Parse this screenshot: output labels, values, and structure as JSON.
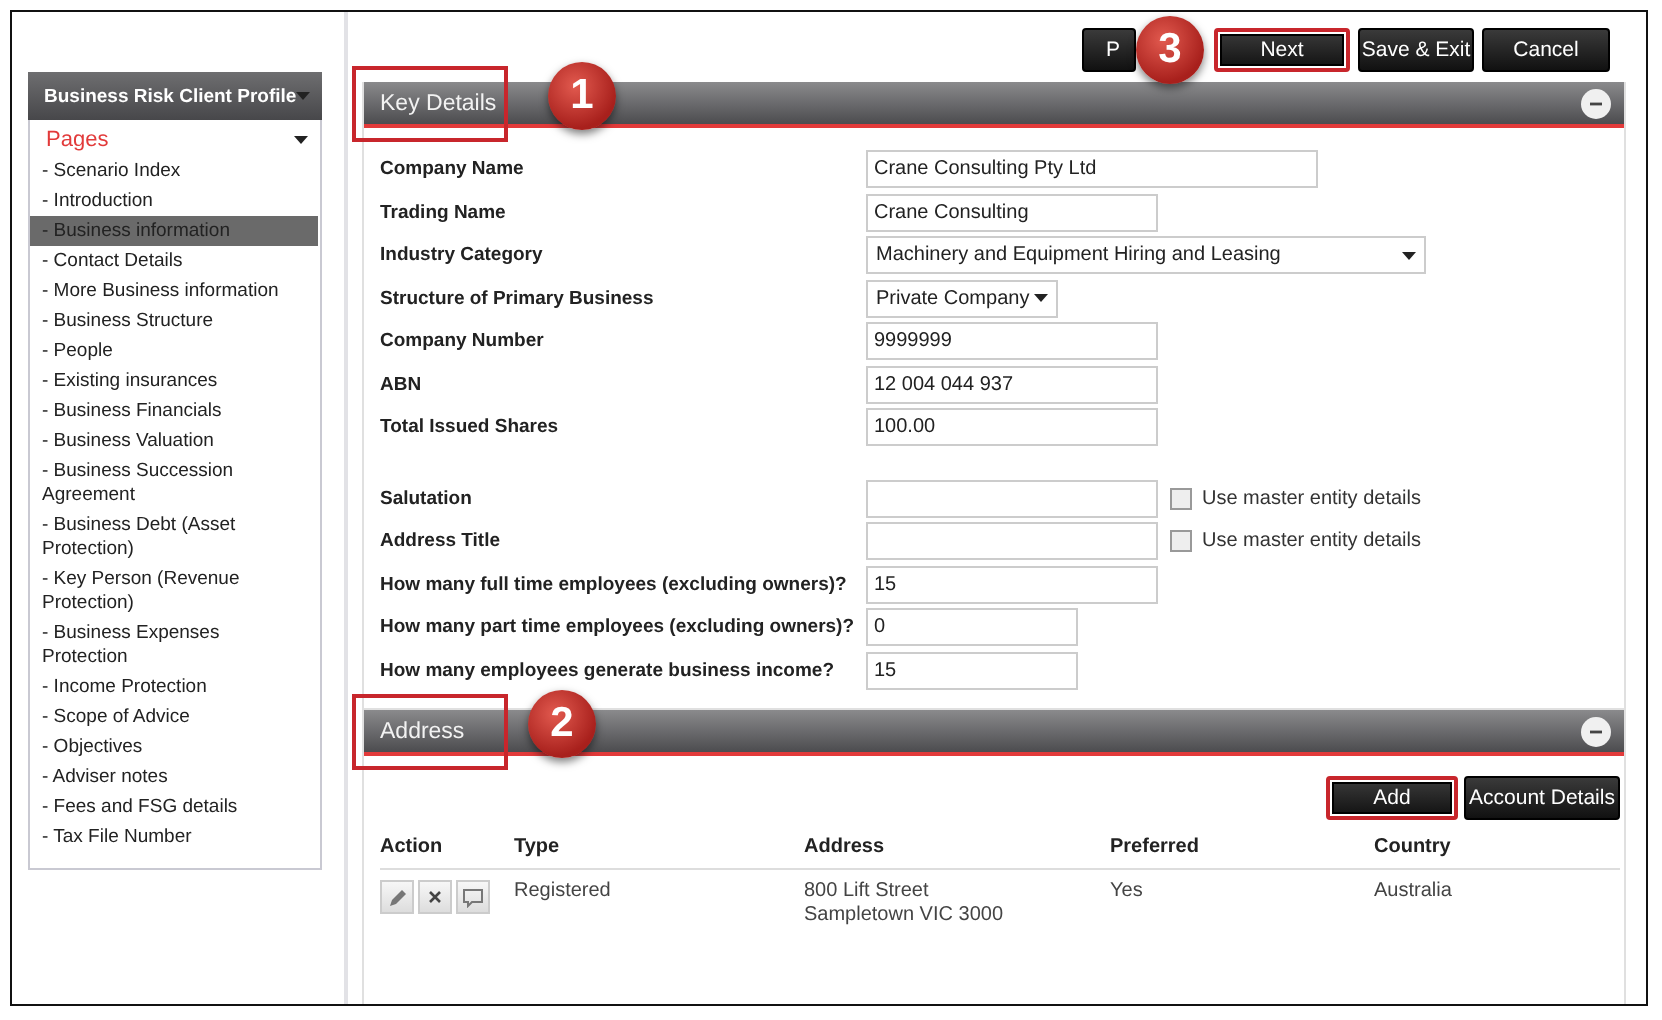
{
  "sidebar": {
    "title": "Business Risk Client Profile",
    "section": "Pages",
    "items": [
      {
        "label": "- Scenario Index",
        "selected": false
      },
      {
        "label": "- Introduction",
        "selected": false
      },
      {
        "label": "- Business information",
        "selected": true
      },
      {
        "label": "- Contact Details",
        "selected": false
      },
      {
        "label": "- More Business information",
        "selected": false
      },
      {
        "label": "- Business Structure",
        "selected": false
      },
      {
        "label": "- People",
        "selected": false
      },
      {
        "label": "- Existing insurances",
        "selected": false
      },
      {
        "label": "- Business Financials",
        "selected": false
      },
      {
        "label": "- Business Valuation",
        "selected": false
      },
      {
        "label": "- Business Succession Agreement",
        "selected": false
      },
      {
        "label": "- Business Debt (Asset Protection)",
        "selected": false
      },
      {
        "label": "- Key Person (Revenue Protection)",
        "selected": false
      },
      {
        "label": "- Business Expenses Protection",
        "selected": false
      },
      {
        "label": "- Income Protection",
        "selected": false
      },
      {
        "label": "- Scope of Advice",
        "selected": false
      },
      {
        "label": "- Objectives",
        "selected": false
      },
      {
        "label": "- Adviser notes",
        "selected": false
      },
      {
        "label": "- Fees and FSG details",
        "selected": false
      },
      {
        "label": "- Tax File Number",
        "selected": false
      }
    ]
  },
  "toolbar": {
    "buttons": [
      {
        "label": "P",
        "highlighted": false,
        "badge": "3"
      },
      {
        "label": "Next",
        "highlighted": true
      },
      {
        "label": "Save & Exit",
        "highlighted": false
      },
      {
        "label": "Cancel",
        "highlighted": false
      }
    ]
  },
  "key_details": {
    "title": "Key Details",
    "highlighted": true,
    "badge": "1",
    "fields": [
      {
        "label": "Company Name",
        "kind": "text",
        "value": "Crane Consulting Pty Ltd"
      },
      {
        "label": "Trading Name",
        "kind": "text",
        "value": "Crane Consulting"
      },
      {
        "label": "Industry Category",
        "kind": "select",
        "value": "Machinery and Equipment Hiring and Leasing"
      },
      {
        "label": "Structure of Primary Business",
        "kind": "select",
        "value": "Private Company"
      },
      {
        "label": "Company Number",
        "kind": "text",
        "value": "9999999"
      },
      {
        "label": "ABN",
        "kind": "text",
        "value": "12 004 044 937"
      },
      {
        "label": "Total Issued Shares",
        "kind": "text",
        "value": "100.00"
      },
      {
        "label": "Salutation",
        "kind": "text_checkbox",
        "option": "Use master entity details",
        "checked": false
      },
      {
        "label": "Address Title",
        "kind": "text_checkbox",
        "option": "Use master entity details",
        "checked": false
      },
      {
        "label": "How many full time employees (excluding owners)?",
        "kind": "text",
        "value": "15"
      },
      {
        "label": "How many part time employees (excluding owners)?",
        "kind": "text",
        "value": "0"
      },
      {
        "label": "How many employees generate business income?",
        "kind": "text",
        "value": "15"
      }
    ]
  },
  "address": {
    "title": "Address",
    "highlighted": true,
    "badge": "2",
    "buttons": [
      {
        "label": "Add",
        "highlighted": true
      },
      {
        "label": "Account Details",
        "highlighted": false
      }
    ],
    "columns": [
      "Action",
      "Type",
      "Address",
      "Preferred",
      "Country"
    ],
    "rows": [
      {
        "type": "Registered",
        "address_lines": [
          "800 Lift Street",
          "Sampletown VIC 3000"
        ],
        "preferred": "Yes",
        "country": "Australia"
      }
    ]
  }
}
